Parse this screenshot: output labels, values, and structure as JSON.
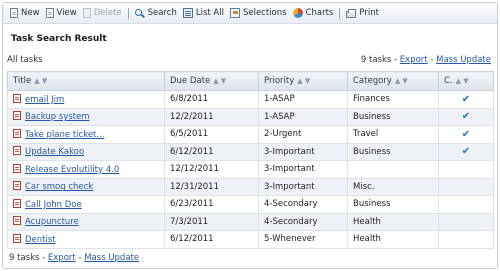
{
  "toolbar": {
    "new": "New",
    "view": "View",
    "delete": "Delete",
    "search": "Search",
    "list_all": "List All",
    "selections": "Selections",
    "charts": "Charts",
    "print": "Print"
  },
  "page": {
    "title": "Task Search Result",
    "filter_label": "All tasks",
    "count_text": "9 tasks - ",
    "export": "Export",
    "separator": " - ",
    "mass_update": "Mass Update"
  },
  "columns": {
    "title": "Title",
    "due_date": "Due Date",
    "priority": "Priority",
    "category": "Category",
    "completed": "C."
  },
  "sort_glyph": "▲ ▼",
  "check_glyph": "✔",
  "rows": [
    {
      "title": "email Jim",
      "due": "6/8/2011",
      "priority": "1-ASAP",
      "category": "Finances",
      "done": true
    },
    {
      "title": "Backup system",
      "due": "12/2/2011",
      "priority": "1-ASAP",
      "category": "Business",
      "done": true
    },
    {
      "title": "Take plane ticket...",
      "due": "6/5/2011",
      "priority": "2-Urgent",
      "category": "Travel",
      "done": true
    },
    {
      "title": "Update Kakoo",
      "due": "6/12/2011",
      "priority": "3-Important",
      "category": "Business",
      "done": true
    },
    {
      "title": "Release Evolutility 4.0",
      "due": "12/12/2011",
      "priority": "3-Important",
      "category": "",
      "done": false
    },
    {
      "title": "Car smog check",
      "due": "12/31/2011",
      "priority": "3-Important",
      "category": "Misc.",
      "done": false
    },
    {
      "title": "Call John Doe",
      "due": "6/23/2011",
      "priority": "4-Secondary",
      "category": "Business",
      "done": false
    },
    {
      "title": "Acupuncture",
      "due": "7/3/2011",
      "priority": "4-Secondary",
      "category": "Health",
      "done": false
    },
    {
      "title": "Dentist",
      "due": "6/12/2011",
      "priority": "5-Whenever",
      "category": "Health",
      "done": false
    }
  ]
}
